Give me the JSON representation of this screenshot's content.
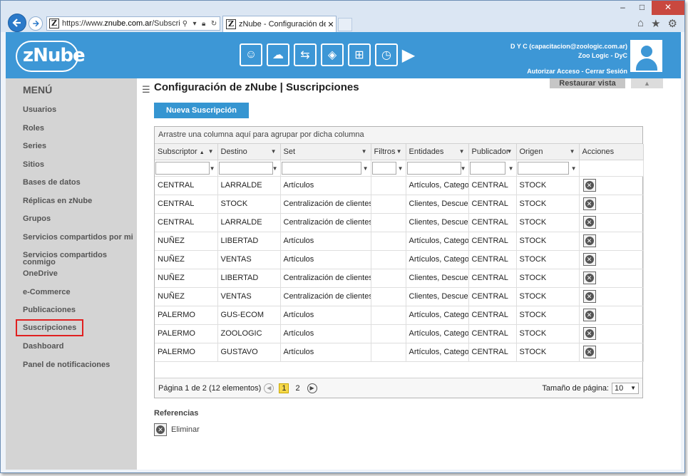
{
  "browser": {
    "url_prefix": "https://www.",
    "url_domain": "znube.com.ar",
    "url_rest": "/Subscriptio",
    "tab_title": "zNube - Configuración de z...",
    "tab_close": "✕",
    "favicon": "Z",
    "window_controls": [
      "–",
      "□",
      "✕"
    ],
    "icons": [
      "home-icon",
      "star-icon",
      "gear-icon"
    ]
  },
  "header": {
    "logo": "zNube",
    "user_line1": "D Y C (capacitacion@zoologic.com.ar)",
    "user_line2": "Zoo Logic - DyC",
    "links": "Autorizar Acceso - Cerrar Sesión",
    "modules": [
      "users-gear-icon",
      "cloud-gear-icon",
      "sync-icon",
      "box-icon",
      "cart-icon",
      "clock-icon"
    ]
  },
  "sidebar": {
    "title": "MENÚ",
    "items": [
      {
        "label": "Usuarios"
      },
      {
        "label": "Roles"
      },
      {
        "label": "Series"
      },
      {
        "label": "Sitios"
      },
      {
        "label": "Bases de datos"
      },
      {
        "label": "Réplicas en zNube"
      },
      {
        "label": "Grupos"
      },
      {
        "label": "Servicios compartidos por mi"
      },
      {
        "label": "Servicios compartidos conmigo"
      },
      {
        "label": "OneDrive"
      },
      {
        "label": "e-Commerce"
      },
      {
        "label": "Publicaciones"
      },
      {
        "label": "Suscripciones"
      },
      {
        "label": "Dashboard"
      },
      {
        "label": "Panel de notificaciones"
      }
    ]
  },
  "main": {
    "title": "Configuración de zNube | Suscripciones",
    "restaurar": "Restaurar vista",
    "new_button": "Nueva Suscripción",
    "group_panel": "Arrastre una columna aquí para agrupar por dicha columna",
    "columns": [
      "Subscriptor",
      "Destino",
      "Set",
      "Filtros",
      "Entidades",
      "Publicador",
      "Origen",
      "Acciones"
    ],
    "rows": [
      [
        "CENTRAL",
        "LARRALDE",
        "Artículos",
        "",
        "Artículos, Categorí",
        "CENTRAL",
        "STOCK"
      ],
      [
        "CENTRAL",
        "STOCK",
        "Centralización de clientes",
        "",
        "Clientes, Descuent",
        "CENTRAL",
        "STOCK"
      ],
      [
        "CENTRAL",
        "LARRALDE",
        "Centralización de clientes",
        "",
        "Clientes, Descuent",
        "CENTRAL",
        "STOCK"
      ],
      [
        "NUÑEZ",
        "LIBERTAD",
        "Artículos",
        "",
        "Artículos, Categorí",
        "CENTRAL",
        "STOCK"
      ],
      [
        "NUÑEZ",
        "VENTAS",
        "Artículos",
        "",
        "Artículos, Categorí",
        "CENTRAL",
        "STOCK"
      ],
      [
        "NUÑEZ",
        "LIBERTAD",
        "Centralización de clientes",
        "",
        "Clientes, Descuent",
        "CENTRAL",
        "STOCK"
      ],
      [
        "NUÑEZ",
        "VENTAS",
        "Centralización de clientes",
        "",
        "Clientes, Descuent",
        "CENTRAL",
        "STOCK"
      ],
      [
        "PALERMO",
        "GUS-ECOM",
        "Artículos",
        "",
        "Artículos, Categorí",
        "CENTRAL",
        "STOCK"
      ],
      [
        "PALERMO",
        "ZOOLOGIC",
        "Artículos",
        "",
        "Artículos, Categorí",
        "CENTRAL",
        "STOCK"
      ],
      [
        "PALERMO",
        "GUSTAVO",
        "Artículos",
        "",
        "Artículos, Categorí",
        "CENTRAL",
        "STOCK"
      ]
    ],
    "pager": {
      "summary": "Página 1 de 2 (12 elementos)",
      "pages": [
        "1",
        "2"
      ],
      "size_label": "Tamaño de página:",
      "size_value": "10"
    },
    "refs_title": "Referencias",
    "refs_delete": "Eliminar"
  },
  "colors": {
    "header_bg": "#3d97d6",
    "sidebar_bg": "#d4d4d4",
    "button_bg": "#3595d1",
    "active_outline": "#e02020"
  }
}
